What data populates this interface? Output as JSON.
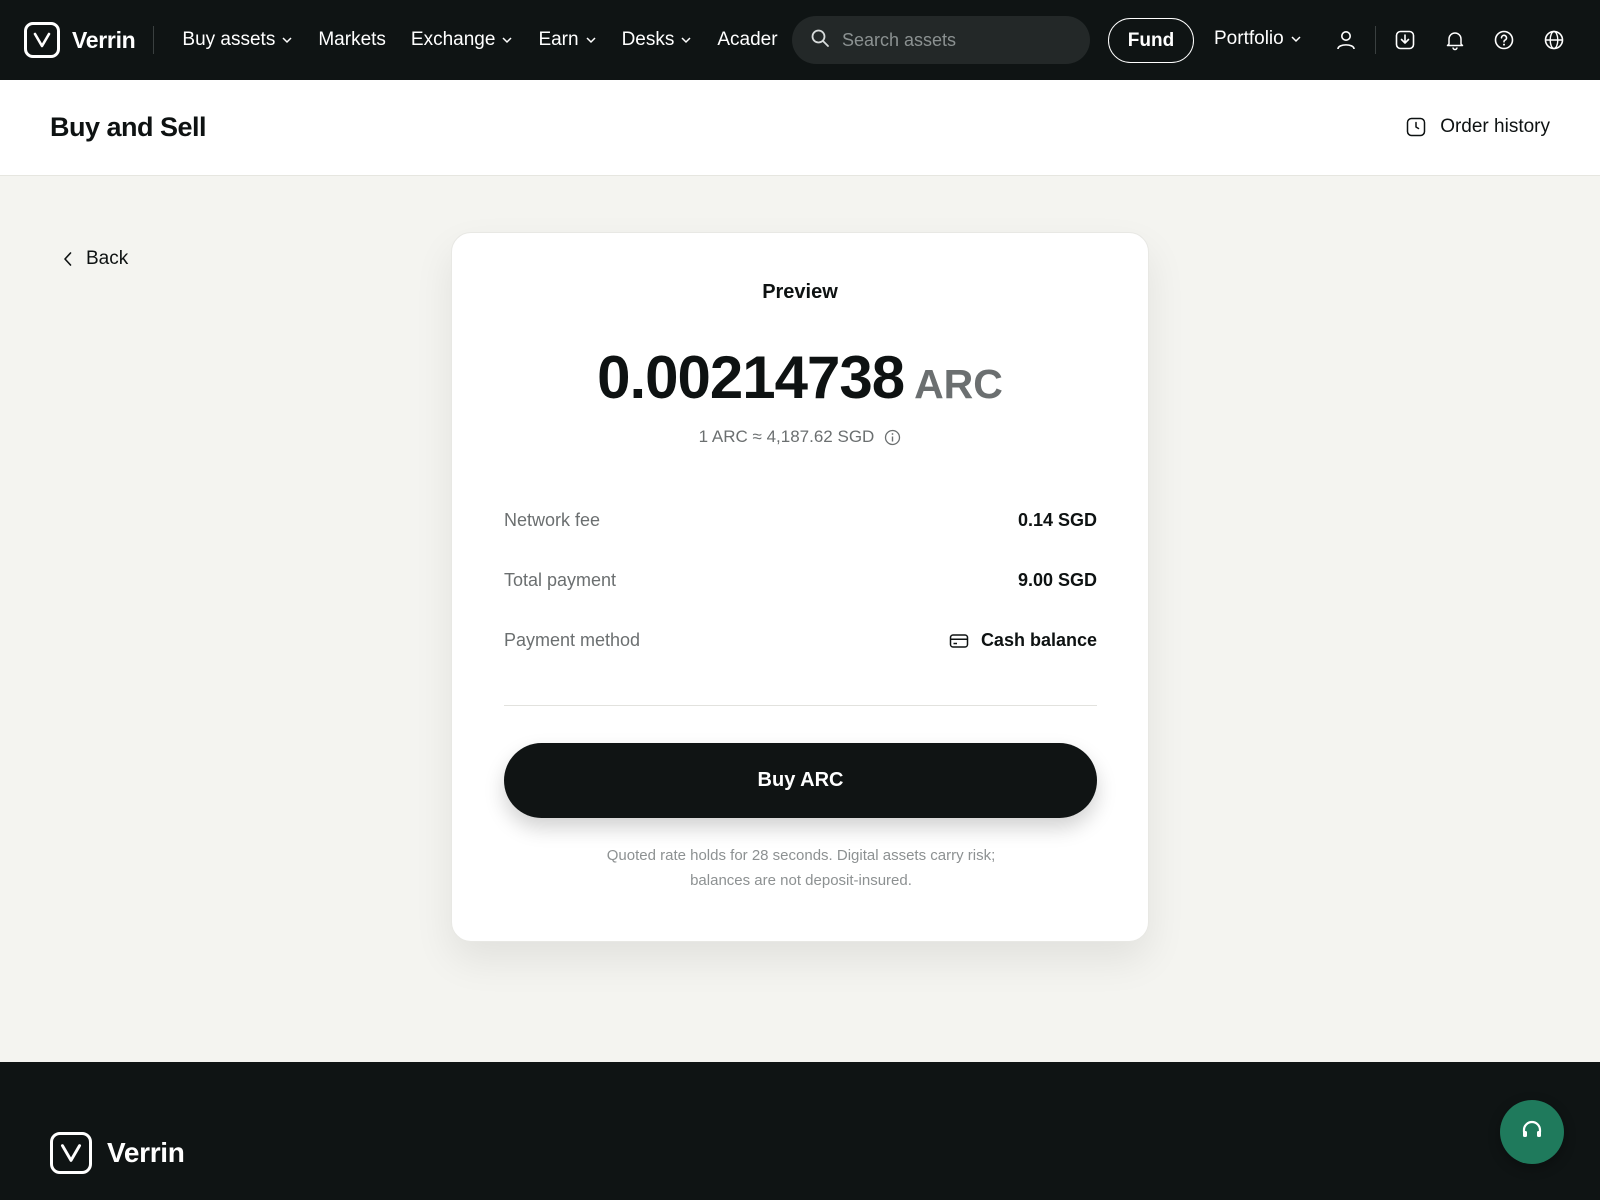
{
  "brand": {
    "name": "Verrin",
    "logo_icon": "verrin-v-logo"
  },
  "nav": {
    "items": [
      {
        "label": "Buy assets",
        "has_dropdown": true
      },
      {
        "label": "Markets",
        "has_dropdown": false
      },
      {
        "label": "Exchange",
        "has_dropdown": true
      },
      {
        "label": "Earn",
        "has_dropdown": true
      },
      {
        "label": "Desks",
        "has_dropdown": true
      },
      {
        "label": "Acader",
        "has_dropdown": false
      }
    ],
    "search_placeholder": "Search assets",
    "fund_label": "Fund",
    "portfolio_label": "Portfolio",
    "icons": [
      "user-icon",
      "download-icon",
      "bell-icon",
      "help-icon",
      "globe-icon"
    ]
  },
  "page": {
    "title": "Buy and Sell",
    "order_history_label": "Order history",
    "back_label": "Back"
  },
  "preview": {
    "title": "Preview",
    "amount": "0.00214738",
    "unit": "ARC",
    "rate": "1 ARC ≈ 4,187.62 SGD",
    "rows": [
      {
        "label": "Network fee",
        "value": "0.14 SGD"
      },
      {
        "label": "Total payment",
        "value": "9.00 SGD"
      },
      {
        "label": "Payment method",
        "value": "Cash balance",
        "icon": "card-icon"
      }
    ],
    "buy_label": "Buy ARC",
    "disclaimer_line1": "Quoted rate holds for 28 seconds. Digital assets carry risk;",
    "disclaimer_line2": "balances are not deposit-insured."
  },
  "footer": {
    "brand_name": "Verrin"
  },
  "colors": {
    "nav_bg": "#0f1414",
    "page_bg": "#f4f4f0",
    "support_green": "#1f7a5c",
    "muted_text": "#6b6f70"
  }
}
